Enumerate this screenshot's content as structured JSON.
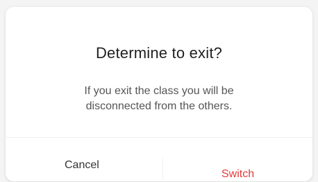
{
  "dialog": {
    "title": "Determine to exit?",
    "message": "If you exit the class you will be disconnected from the others.",
    "cancel_label": "Cancel",
    "confirm_label": "Switch"
  },
  "colors": {
    "confirm": "#e23b3b",
    "title": "#1f1f1f",
    "message": "#555555"
  }
}
